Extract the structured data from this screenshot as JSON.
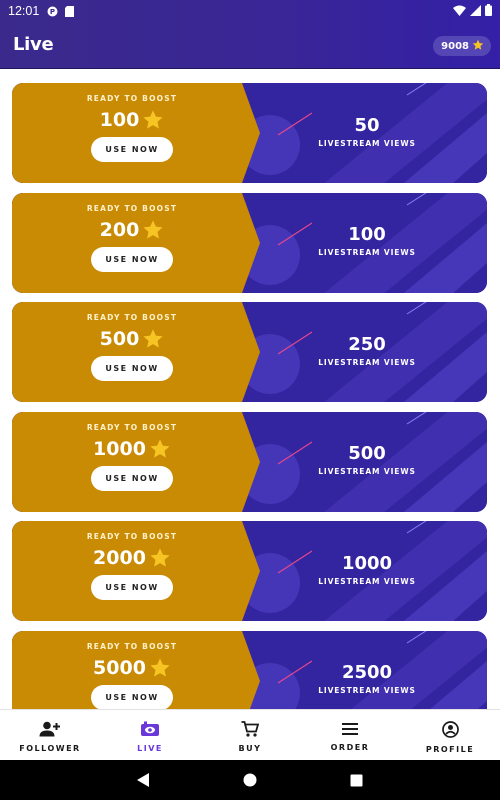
{
  "status_bar": {
    "time": "12:01"
  },
  "app_bar": {
    "title": "Live",
    "coins": "9008"
  },
  "cards": [
    {
      "ready_label": "READY TO BOOST",
      "cost": "100",
      "button_label": "USE NOW",
      "views": "50",
      "views_label": "LIVESTREAM VIEWS"
    },
    {
      "ready_label": "READY TO BOOST",
      "cost": "200",
      "button_label": "USE NOW",
      "views": "100",
      "views_label": "LIVESTREAM VIEWS"
    },
    {
      "ready_label": "READY TO BOOST",
      "cost": "500",
      "button_label": "USE NOW",
      "views": "250",
      "views_label": "LIVESTREAM VIEWS"
    },
    {
      "ready_label": "READY TO BOOST",
      "cost": "1000",
      "button_label": "USE NOW",
      "views": "500",
      "views_label": "LIVESTREAM VIEWS"
    },
    {
      "ready_label": "READY TO BOOST",
      "cost": "2000",
      "button_label": "USE NOW",
      "views": "1000",
      "views_label": "LIVESTREAM VIEWS"
    },
    {
      "ready_label": "READY TO BOOST",
      "cost": "5000",
      "button_label": "USE NOW",
      "views": "2500",
      "views_label": "LIVESTREAM VIEWS"
    }
  ],
  "bottom_nav": {
    "items": [
      {
        "label": "FOLLOWER",
        "icon": "add-person-icon"
      },
      {
        "label": "LIVE",
        "icon": "live-tv-icon",
        "active": true
      },
      {
        "label": "BUY",
        "icon": "cart-icon"
      },
      {
        "label": "ORDER",
        "icon": "list-icon"
      },
      {
        "label": "PROFILE",
        "icon": "profile-icon"
      }
    ]
  },
  "colors": {
    "header_purple": "#3a2696",
    "card_gold": "#c98a04",
    "card_purple": "#3324a0",
    "active_nav": "#6a38d8",
    "star": "#f6c423"
  }
}
